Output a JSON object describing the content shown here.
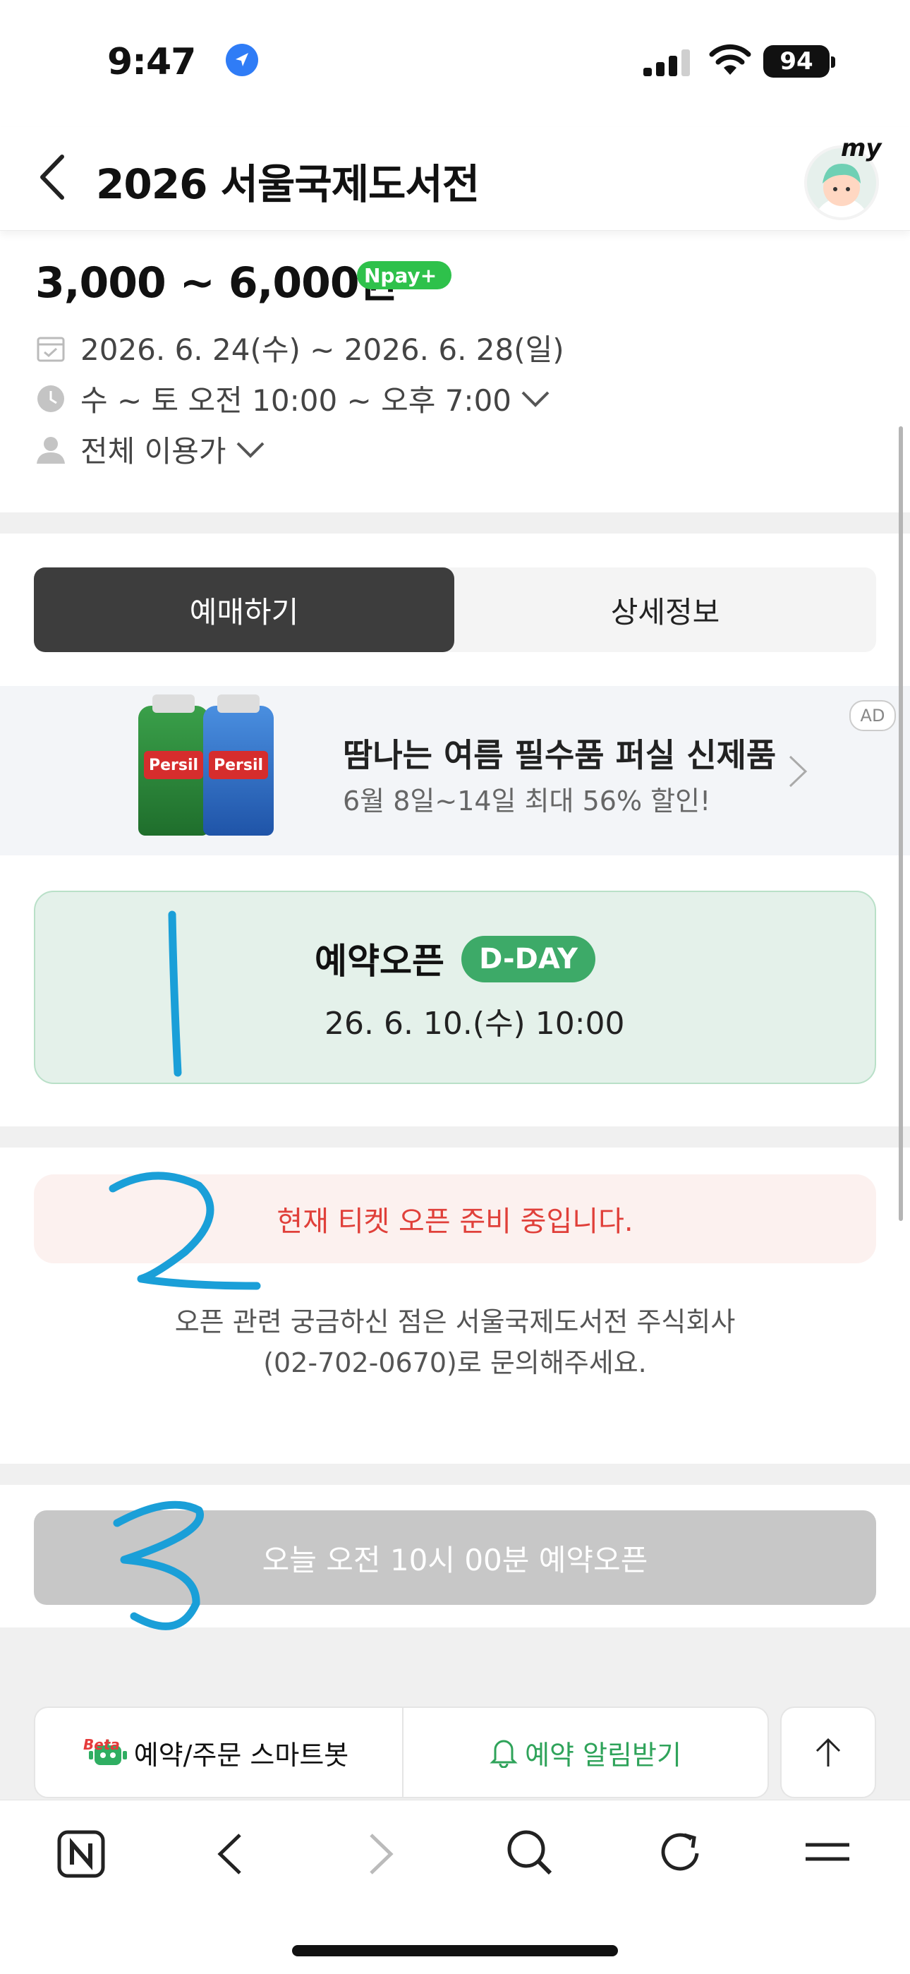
{
  "status_bar": {
    "time": "9:47",
    "battery": "94"
  },
  "header": {
    "title": "2026 서울국제도서전",
    "avatar_badge": "my"
  },
  "event": {
    "price": "3,000 ~ 6,000원",
    "npay": "Npay+",
    "date_range": "2026. 6. 24(수) ~ 2026. 6. 28(일)",
    "hours": "수 ~ 토 오전 10:00 ~ 오후 7:00",
    "audience": "전체 이용가"
  },
  "tabs": {
    "booking": "예매하기",
    "details": "상세정보"
  },
  "ad": {
    "title": "땀나는 여름 필수품 퍼실 신제품",
    "subtitle": "6월 8일~14일 최대 56% 할인!",
    "badge": "AD",
    "brand": "Persil"
  },
  "reservation": {
    "label": "예약오픈",
    "dday": "D-DAY",
    "datetime": "26. 6. 10.(수) 10:00"
  },
  "notice": {
    "message": "현재 티켓 오픈 준비 중입니다.",
    "contact_line1": "오픈 관련 궁금하신 점은 서울국제도서전 주식회사",
    "contact_line2": "(02-702-0670)로 문의해주세요."
  },
  "open_button": "오늘 오전 10시 00분 예약오픈",
  "bottom_actions": {
    "smartbot": "예약/주문 스마트봇",
    "beta": "Beta",
    "notify": "예약 알림받기"
  },
  "annotations": [
    "1",
    "2",
    "3"
  ],
  "colors": {
    "accent_green": "#3daa68",
    "notice_red": "#e0403a",
    "annotation_blue": "#1a9fd8"
  }
}
